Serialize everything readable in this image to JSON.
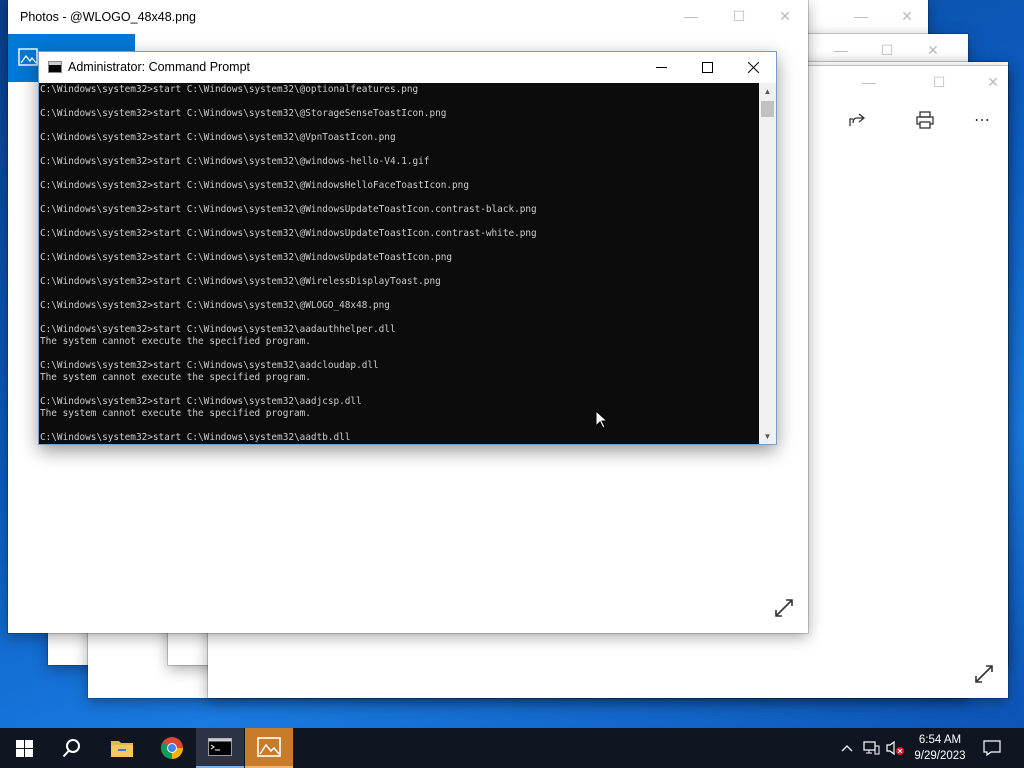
{
  "photos_windows": {
    "front_title": "Photos - @WLOGO_48x48.png"
  },
  "cmd": {
    "title": "Administrator: Command Prompt",
    "lines": [
      "C:\\Windows\\system32>start C:\\Windows\\system32\\@optionalfeatures.png",
      "",
      "C:\\Windows\\system32>start C:\\Windows\\system32\\@StorageSenseToastIcon.png",
      "",
      "C:\\Windows\\system32>start C:\\Windows\\system32\\@VpnToastIcon.png",
      "",
      "C:\\Windows\\system32>start C:\\Windows\\system32\\@windows-hello-V4.1.gif",
      "",
      "C:\\Windows\\system32>start C:\\Windows\\system32\\@WindowsHelloFaceToastIcon.png",
      "",
      "C:\\Windows\\system32>start C:\\Windows\\system32\\@WindowsUpdateToastIcon.contrast-black.png",
      "",
      "C:\\Windows\\system32>start C:\\Windows\\system32\\@WindowsUpdateToastIcon.contrast-white.png",
      "",
      "C:\\Windows\\system32>start C:\\Windows\\system32\\@WindowsUpdateToastIcon.png",
      "",
      "C:\\Windows\\system32>start C:\\Windows\\system32\\@WirelessDisplayToast.png",
      "",
      "C:\\Windows\\system32>start C:\\Windows\\system32\\@WLOGO_48x48.png",
      "",
      "C:\\Windows\\system32>start C:\\Windows\\system32\\aadauthhelper.dll",
      "The system cannot execute the specified program.",
      "",
      "C:\\Windows\\system32>start C:\\Windows\\system32\\aadcloudap.dll",
      "The system cannot execute the specified program.",
      "",
      "C:\\Windows\\system32>start C:\\Windows\\system32\\aadjcsp.dll",
      "The system cannot execute the specified program.",
      "",
      "C:\\Windows\\system32>start C:\\Windows\\system32\\aadtb.dll"
    ]
  },
  "taskbar": {
    "time": "6:54 AM",
    "date": "9/29/2023",
    "icons": [
      "windows-start-icon",
      "search-icon",
      "file-explorer-icon",
      "chrome-icon",
      "command-prompt-icon",
      "photos-icon"
    ]
  },
  "colors": {
    "accent": "#0078d7",
    "console_bg": "#0c0c0c",
    "console_fg": "#cccccc",
    "taskbar": "#101522"
  }
}
